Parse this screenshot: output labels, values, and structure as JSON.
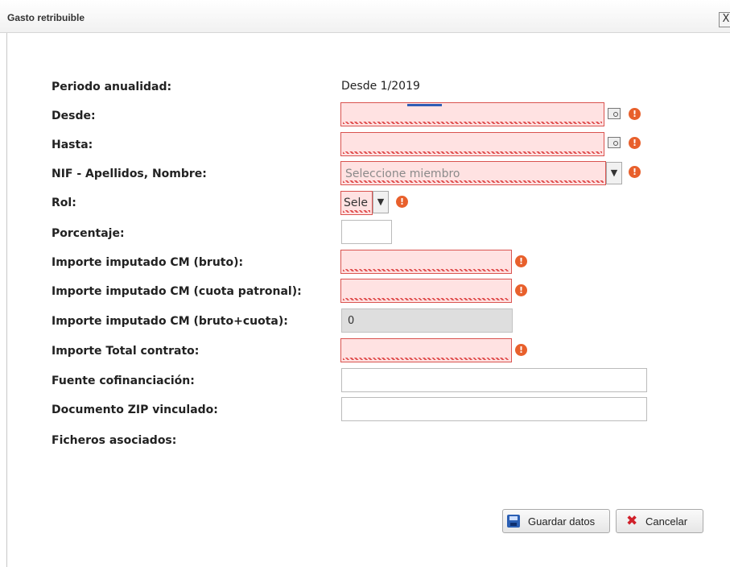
{
  "dialog": {
    "title": "Gasto retribuible",
    "close_label": "X"
  },
  "form": {
    "periodo": {
      "label": "Periodo anualidad:",
      "value": "Desde 1/2019"
    },
    "desde": {
      "label": "Desde:",
      "value": ""
    },
    "hasta": {
      "label": "Hasta:",
      "value": ""
    },
    "nif": {
      "label": "NIF - Apellidos, Nombre:",
      "placeholder": "Seleccione miembro"
    },
    "rol": {
      "label": "Rol:",
      "value": "Sele"
    },
    "porcentaje": {
      "label": "Porcentaje:",
      "value": ""
    },
    "bruto": {
      "label": "Importe imputado CM (bruto):",
      "value": ""
    },
    "cuota": {
      "label": "Importe imputado CM (cuota patronal):",
      "value": ""
    },
    "bruto_cuota": {
      "label": "Importe imputado CM (bruto+cuota):",
      "value": "0"
    },
    "total": {
      "label": "Importe Total contrato:",
      "value": ""
    },
    "fuente": {
      "label": "Fuente cofinanciación:",
      "value": ""
    },
    "zip": {
      "label": "Documento ZIP vinculado:",
      "value": ""
    },
    "ficheros": {
      "label": "Ficheros asociados:"
    }
  },
  "error_icon": "!",
  "dropdown_arrow": "▼",
  "buttons": {
    "save": "Guardar datos",
    "cancel": "Cancelar",
    "cancel_icon": "✖"
  }
}
